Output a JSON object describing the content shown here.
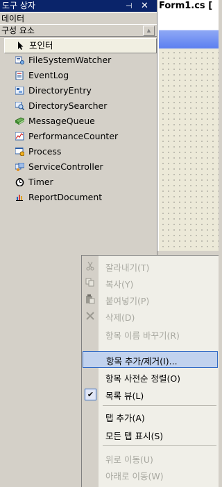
{
  "toolbox": {
    "title": "도구 상자",
    "pin_glyph": "⊣",
    "close_glyph": "✕",
    "tabs": {
      "data": "데이터",
      "components": "구성 요소"
    },
    "scroll_glyph": "▲",
    "items": [
      {
        "label": "포인터",
        "icon": "pointer-icon"
      },
      {
        "label": "FileSystemWatcher",
        "icon": "file-system-watcher-icon"
      },
      {
        "label": "EventLog",
        "icon": "event-log-icon"
      },
      {
        "label": "DirectoryEntry",
        "icon": "directory-entry-icon"
      },
      {
        "label": "DirectorySearcher",
        "icon": "directory-searcher-icon"
      },
      {
        "label": "MessageQueue",
        "icon": "message-queue-icon"
      },
      {
        "label": "PerformanceCounter",
        "icon": "performance-counter-icon"
      },
      {
        "label": "Process",
        "icon": "process-icon"
      },
      {
        "label": "ServiceController",
        "icon": "service-controller-icon"
      },
      {
        "label": "Timer",
        "icon": "timer-icon"
      },
      {
        "label": "ReportDocument",
        "icon": "report-document-icon"
      }
    ]
  },
  "designer": {
    "tab_label": "Form1.cs ["
  },
  "context_menu": {
    "items": [
      {
        "label": "잘라내기(T)",
        "enabled": false,
        "icon": "cut-icon"
      },
      {
        "label": "복사(Y)",
        "enabled": false,
        "icon": "copy-icon"
      },
      {
        "label": "붙여넣기(P)",
        "enabled": false,
        "icon": "paste-icon"
      },
      {
        "label": "삭제(D)",
        "enabled": false,
        "icon": "delete-icon"
      },
      {
        "label": "항목 이름 바꾸기(R)",
        "enabled": false
      },
      {
        "label": "항목 추가/제거(I)...",
        "enabled": true,
        "highlighted": true
      },
      {
        "label": "항목 사전순 정렬(O)",
        "enabled": true
      },
      {
        "label": "목록 뷰(L)",
        "enabled": true,
        "checked": true,
        "check_glyph": "✔"
      },
      {
        "label": "탭 추가(A)",
        "enabled": true
      },
      {
        "label": "모든 탭 표시(S)",
        "enabled": true
      },
      {
        "label": "위로 이동(U)",
        "enabled": false
      },
      {
        "label": "아래로 이동(W)",
        "enabled": false
      }
    ]
  },
  "colors": {
    "title_bar": "#0a246a",
    "selection": "#316ac5",
    "menu_highlight": "#c1d2ee",
    "disabled_text": "#a8a8a0"
  }
}
